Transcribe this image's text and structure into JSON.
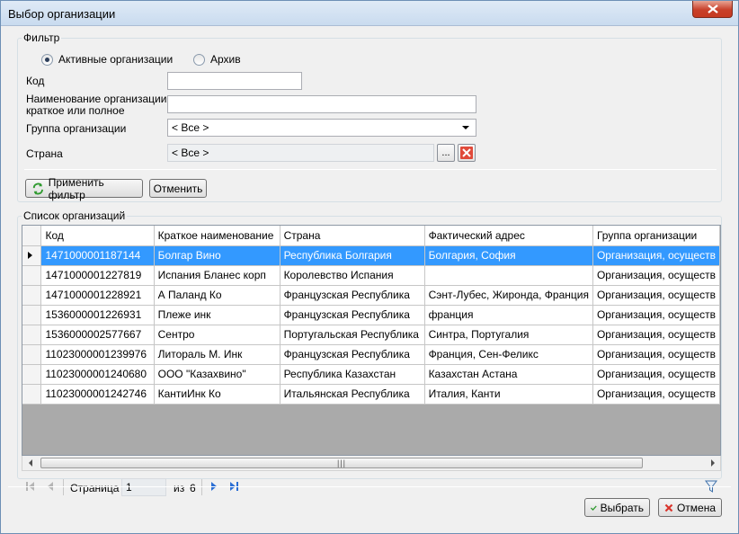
{
  "window": {
    "title": "Выбор организации"
  },
  "filter": {
    "legend": "Фильтр",
    "radio_active": "Активные организации",
    "radio_archive": "Архив",
    "code_label": "Код",
    "code_value": "",
    "name_label_1": "Наименование организации,",
    "name_label_2": "краткое или полное",
    "name_value": "",
    "group_label": "Группа организации",
    "group_value": "< Все >",
    "country_label": "Страна",
    "country_value": "< Все >",
    "browse_label": "...",
    "apply_button": "Применить фильтр",
    "cancel_button": "Отменить"
  },
  "list": {
    "legend": "Список организаций",
    "columns": [
      "Код",
      "Краткое наименование",
      "Страна",
      "Фактический адрес",
      "Группа организации"
    ],
    "rows": [
      [
        "1471000001187144",
        "Болгар Вино",
        "Республика Болгария",
        "Болгария, София",
        "Организация, осуществ"
      ],
      [
        "1471000001227819",
        "Испания Бланес корп",
        "Королевство Испания",
        "",
        "Организация, осуществ"
      ],
      [
        "1471000001228921",
        "А Паланд  Ко",
        "Французская Республика",
        "Сэнт-Лубес, Жиронда, Франция",
        "Организация, осуществ"
      ],
      [
        "1536000001226931",
        "Плеже инк",
        "Французская Республика",
        "франция",
        "Организация, осуществ"
      ],
      [
        "1536000002577667",
        "Сентро",
        "Португальская Республика",
        "Синтра, Португалия",
        "Организация, осуществ"
      ],
      [
        "11023000001239976",
        "Литораль М. Инк",
        "Французская Республика",
        "Франция, Сен-Феликс",
        "Организация, осуществ"
      ],
      [
        "11023000001240680",
        "ООО \"Казахвино\"",
        "Республика Казахстан",
        "Казахстан Астана",
        "Организация, осуществ"
      ],
      [
        "11023000001242746",
        "КантиИнк Ко",
        "Итальянская Республика",
        "Италия, Канти",
        "Организация, осуществ"
      ]
    ],
    "selected_row": 0
  },
  "pager": {
    "page_label": "Страница",
    "page_value": "1",
    "of_label": "из",
    "total_pages": "6"
  },
  "footer": {
    "ok_button": "Выбрать",
    "cancel_button": "Отмена"
  },
  "colors": {
    "selection": "#3399ff",
    "close": "#c8402a",
    "nav_blue": "#2a6ed4"
  },
  "icons": [
    "close-icon",
    "refresh-filter-icon",
    "clear-red-x-icon",
    "first-page-icon",
    "prev-page-icon",
    "next-page-icon",
    "last-page-icon",
    "filter-funnel-icon",
    "checkmark-icon",
    "cancel-x-icon"
  ]
}
